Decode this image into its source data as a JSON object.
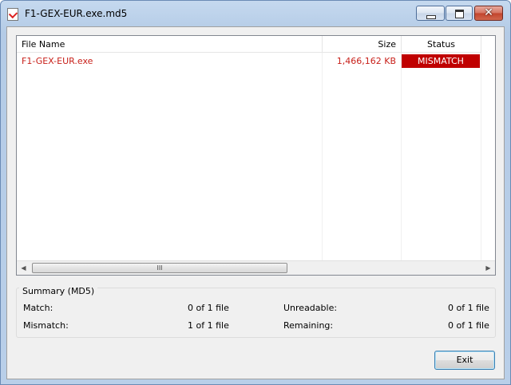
{
  "window": {
    "title": "F1-GEX-EUR.exe.md5"
  },
  "list": {
    "columns": [
      "File Name",
      "Size",
      "Status"
    ],
    "rows": [
      {
        "file_name": "F1-GEX-EUR.exe",
        "size": "1,466,162 KB",
        "status": "MISMATCH"
      }
    ],
    "scroll_thumb_glyph": "III"
  },
  "summary": {
    "title": "Summary (MD5)",
    "match_label": "Match:",
    "match_value": "0 of 1 file",
    "mismatch_label": "Mismatch:",
    "mismatch_value": "1 of 1 file",
    "unreadable_label": "Unreadable:",
    "unreadable_value": "0 of 1 file",
    "remaining_label": "Remaining:",
    "remaining_value": "0 of 1 file"
  },
  "buttons": {
    "exit_label": "Exit"
  },
  "colors": {
    "mismatch_text": "#c8201a",
    "mismatch_bg": "#c00000"
  },
  "icons": {
    "app": "md5-file-icon",
    "minimize": "minimize-icon",
    "maximize": "maximize-icon",
    "close": "close-icon"
  }
}
